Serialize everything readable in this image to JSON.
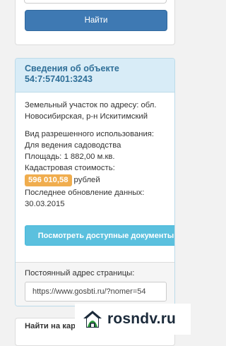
{
  "search": {
    "button_label": "Найти"
  },
  "object": {
    "header": "Сведения об объекте 54:7:57401:3243",
    "description": "Земельный участок по адресу: обл. Новосибирская, р-н Искитимский",
    "usage_label": "Вид разрешенного использования:",
    "usage_value": "Для ведения садоводства",
    "area": "Площадь: 1 882,00 м.кв.",
    "cost_label": "Кадастровая стоимость:",
    "cost_value": "596 010,58",
    "cost_unit": "рублей",
    "updated_label": "Последнее обновление данных:",
    "updated_date": "30.03.2015",
    "docs_button": "Посмотреть доступные документы",
    "permalink_label": "Постоянный адрес страницы:",
    "permalink_value": "https://www.gosbti.ru/?nomer=54"
  },
  "map": {
    "title": "Найти на карте по адресу"
  },
  "watermark": {
    "text": "rosndv.ru",
    "icon": "house-icon"
  },
  "colors": {
    "primary": "#3e79b3",
    "info_header_bg": "#d8ecf7",
    "info_header_text": "#2f6f98",
    "price_badge": "#f0ad4e",
    "docs_button": "#5bc0de"
  }
}
